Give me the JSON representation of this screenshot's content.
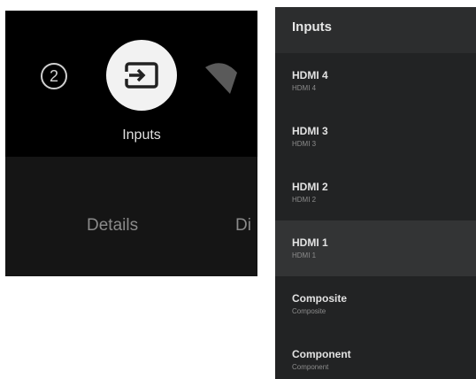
{
  "quick_settings": {
    "number_badge": "2",
    "selected_label": "Inputs",
    "tabs": {
      "details": "Details",
      "partial_next": "Di"
    }
  },
  "inputs_panel": {
    "title": "Inputs",
    "items": [
      {
        "name": "HDMI 4",
        "sub": "HDMI 4"
      },
      {
        "name": "HDMI 3",
        "sub": "HDMI 3"
      },
      {
        "name": "HDMI 2",
        "sub": "HDMI 2"
      },
      {
        "name": "HDMI 1",
        "sub": "HDMI 1"
      },
      {
        "name": "Composite",
        "sub": "Composite"
      },
      {
        "name": "Component",
        "sub": "Component"
      }
    ]
  },
  "icons": {
    "number": "number-2-circle-icon",
    "inputs": "input-source-icon",
    "wifi": "wifi-icon"
  },
  "colors": {
    "left_background": "#000000",
    "left_lower_band": "#151515",
    "inputs_circle": "#f2f2f2",
    "panel_background": "#222324",
    "panel_header": "#2c2d2e",
    "selected_row": "#333435"
  }
}
